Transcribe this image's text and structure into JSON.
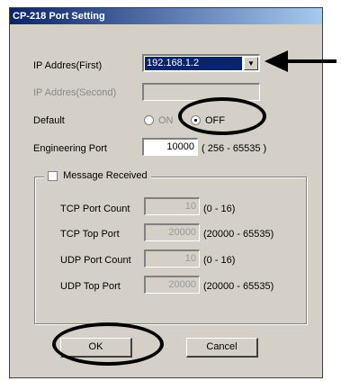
{
  "window": {
    "title": "CP-218 Port Setting"
  },
  "ip_first": {
    "label": "IP Addres(First)",
    "value": "192.168.1.2"
  },
  "ip_second": {
    "label": "IP Addres(Second)",
    "value": ""
  },
  "default": {
    "label": "Default",
    "on_label": "ON",
    "off_label": "OFF",
    "selected": "OFF"
  },
  "engineering_port": {
    "label": "Engineering Port",
    "value": "10000",
    "range": "( 256 - 65535 )"
  },
  "message_received": {
    "label": "Message Received",
    "checked": false,
    "rows": [
      {
        "label": "TCP Port Count",
        "value": "10",
        "range": "(0 - 16)"
      },
      {
        "label": "TCP Top Port",
        "value": "20000",
        "range": "(20000 - 65535)"
      },
      {
        "label": "UDP Port Count",
        "value": "10",
        "range": "(0 - 16)"
      },
      {
        "label": "UDP Top Port",
        "value": "20000",
        "range": "(20000 - 65535)"
      }
    ]
  },
  "buttons": {
    "ok": "OK",
    "cancel": "Cancel"
  },
  "colors": {
    "titlebar_start": "#0a246a",
    "titlebar_end": "#a6caf0",
    "face": "#d4d0c8",
    "selection": "#0a246a"
  }
}
